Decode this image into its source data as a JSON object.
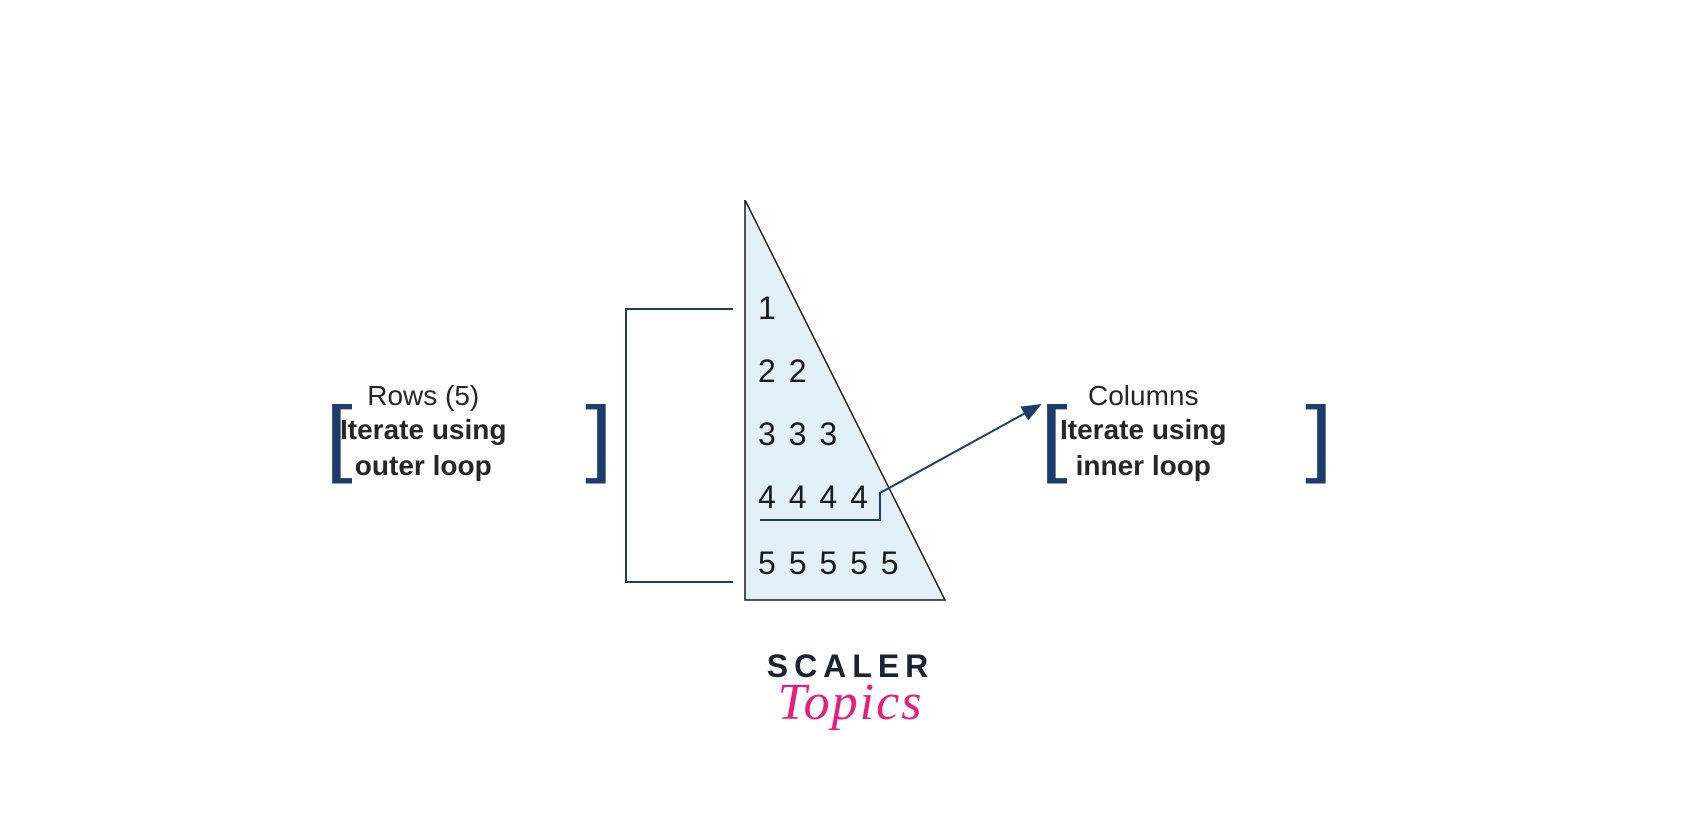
{
  "left_annotation": {
    "title": "Rows (5)",
    "line1": "Iterate using",
    "line2": "outer loop"
  },
  "right_annotation": {
    "title": "Columns",
    "line1": "Iterate using",
    "line2": "inner loop"
  },
  "pattern": {
    "row1": "1",
    "row2": "2 2",
    "row3": "3 3 3",
    "row4": "4 4 4 4",
    "row5": "5 5 5 5 5"
  },
  "logo": {
    "main": "SCALER",
    "sub": "Topics"
  },
  "colors": {
    "bracket": "#1c3c6b",
    "text_dark": "#1a1a1a",
    "label_text": "#262626",
    "triangle_fill": "#e4f0f7",
    "triangle_stroke": "#1a1a1a",
    "logo_dark": "#1a2234",
    "logo_pink": "#e91e7a"
  }
}
